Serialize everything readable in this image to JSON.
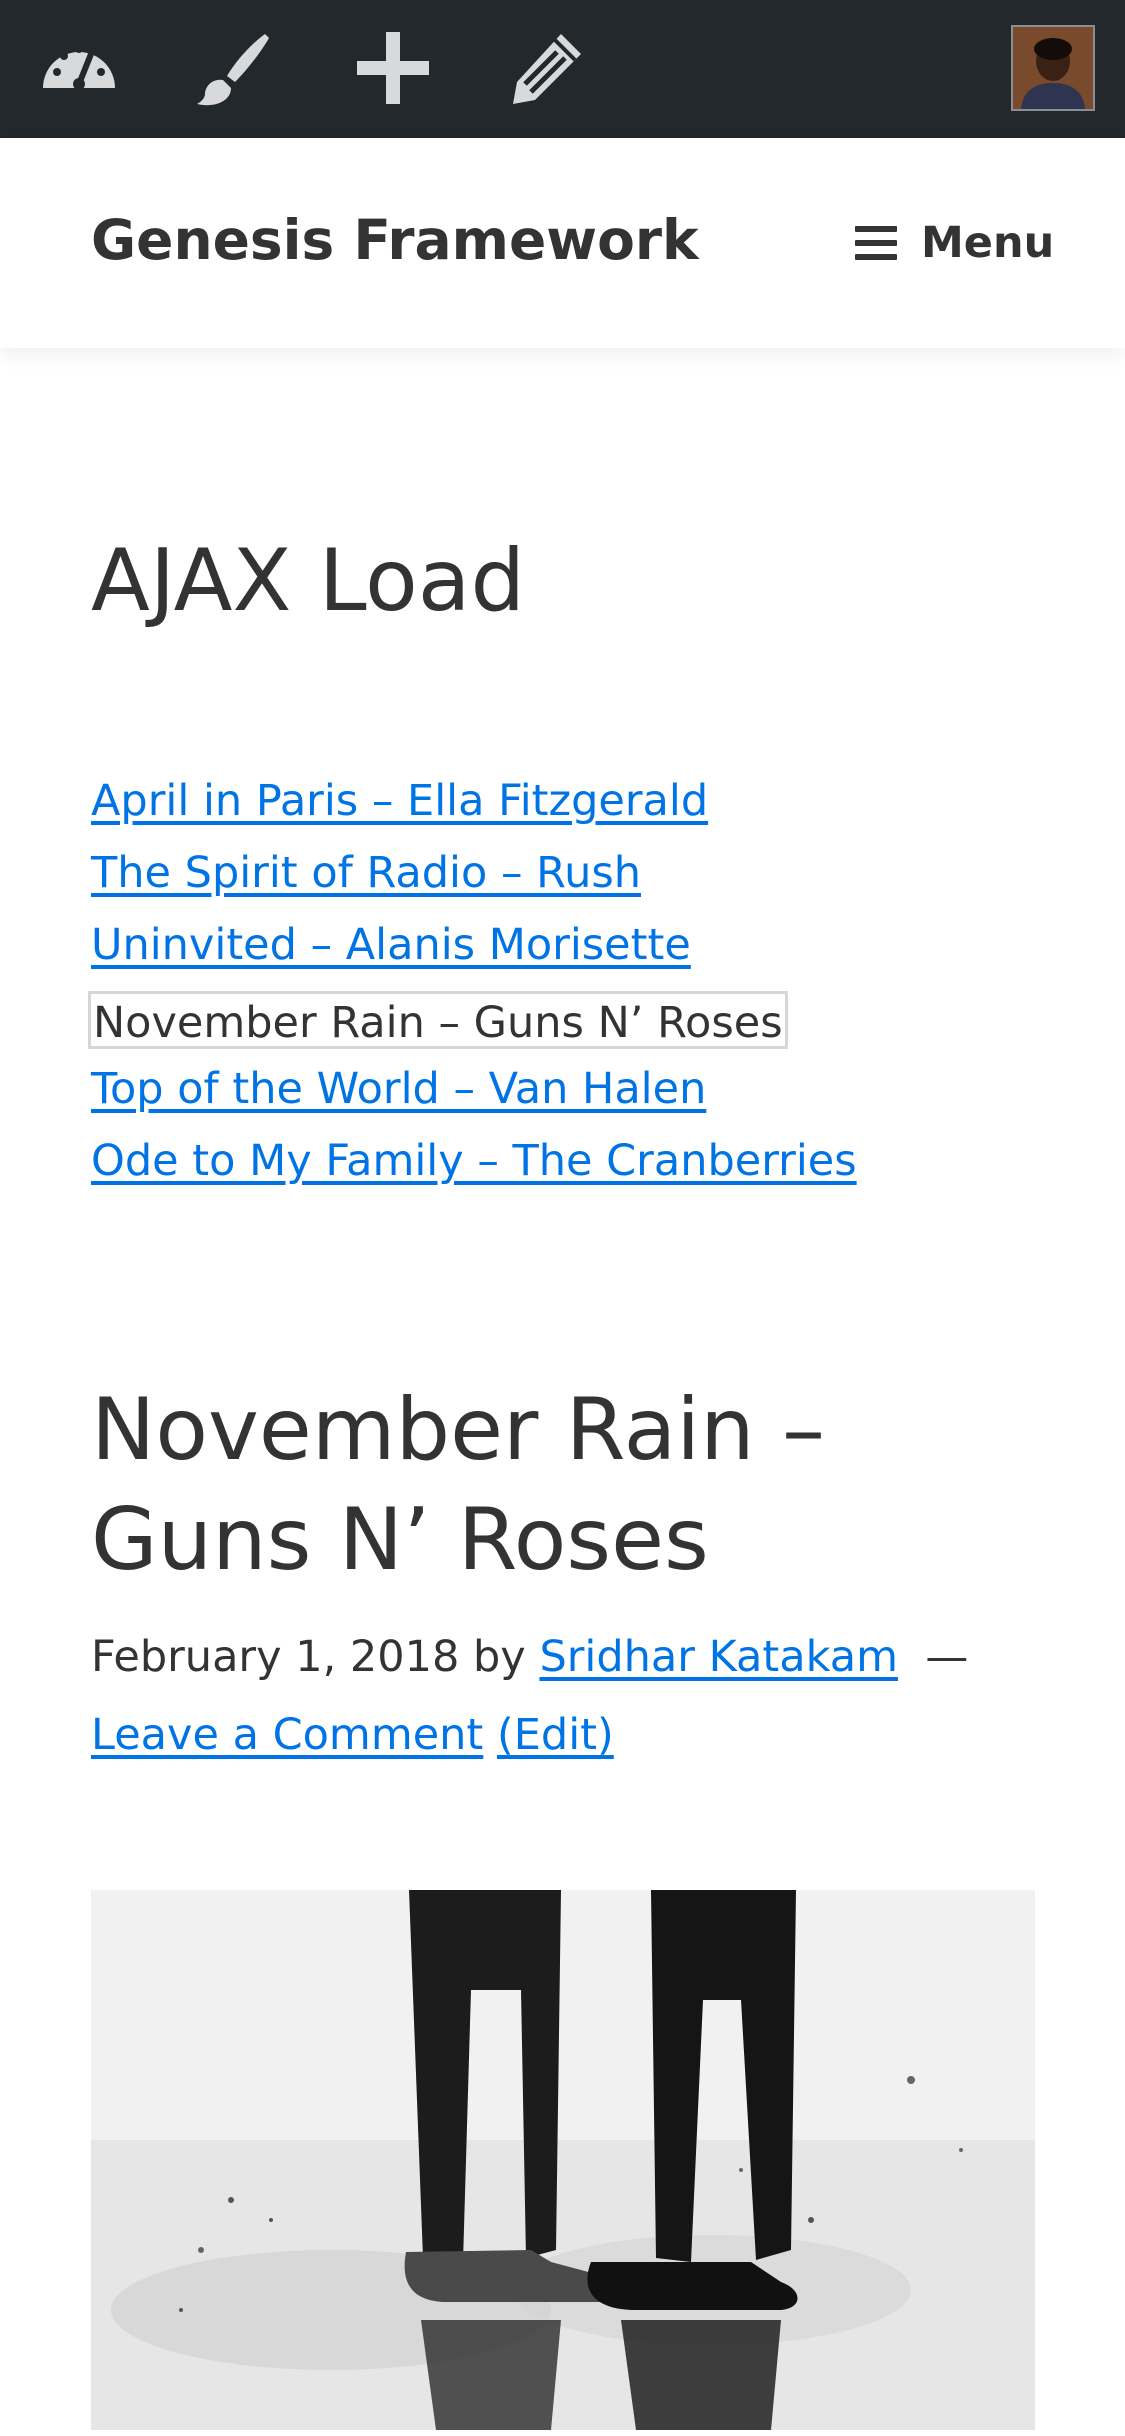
{
  "admin_bar": {
    "icons": [
      "dashboard-icon",
      "customize-brush-icon",
      "new-plus-icon",
      "edit-pencil-icon"
    ],
    "avatar": "user-avatar"
  },
  "header": {
    "site_title": "Genesis Framework",
    "menu_label": "Menu",
    "menu_icon": "hamburger-icon"
  },
  "page": {
    "title": "AJAX Load",
    "songs": [
      {
        "label": "April in Paris – Ella Fitzgerald",
        "is_current": false
      },
      {
        "label": "The Spirit of Radio – Rush",
        "is_current": false
      },
      {
        "label": "Uninvited – Alanis Morisette",
        "is_current": false
      },
      {
        "label": "November Rain – Guns N’ Roses",
        "is_current": true
      },
      {
        "label": "Top of the World – Van Halen",
        "is_current": false
      },
      {
        "label": "Ode to My Family – The Cranberries",
        "is_current": false
      }
    ]
  },
  "post": {
    "title": "November Rain – Guns N’ Roses",
    "date": "February 1, 2018",
    "by": "by",
    "author": "Sridhar Katakam",
    "separator": "—",
    "comment_link": "Leave a Comment",
    "edit_link": "(Edit)"
  },
  "colors": {
    "admin_bar_bg": "#23282d",
    "admin_icon": "#d7d9da",
    "link": "#0073e5",
    "text": "#333333"
  }
}
